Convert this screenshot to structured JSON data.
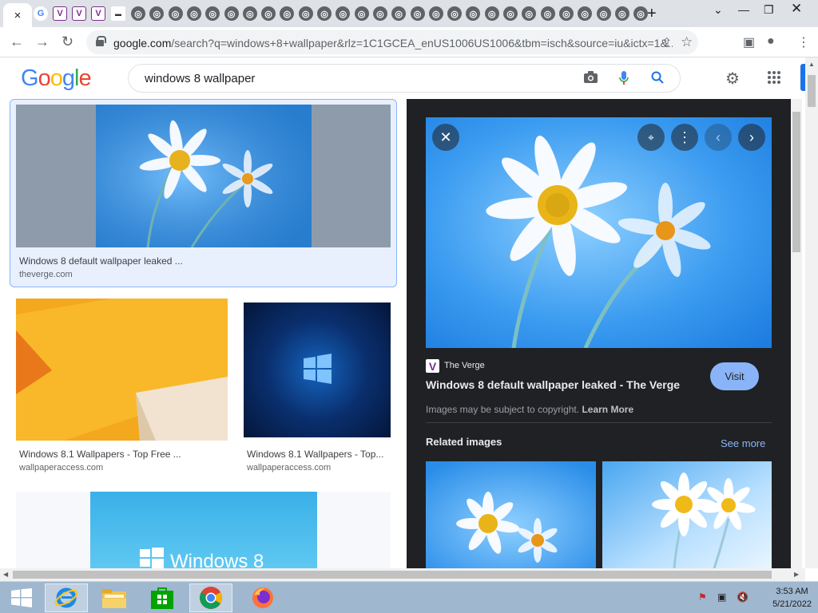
{
  "browser": {
    "active_tab_close": "×",
    "new_tab": "+",
    "url_host": "google.com",
    "url_rest": "/search?q=windows+8+wallpaper&rlz=1C1GCEA_enUS1006US1006&tbm=isch&source=iu&ictx=1&..."
  },
  "google": {
    "logo": "Google",
    "query": "windows 8 wallpaper"
  },
  "results": [
    {
      "title": "Windows 8 default wallpaper leaked ...",
      "source": "theverge.com"
    },
    {
      "title": "Windows 8.1 Wallpapers - Top Free ...",
      "source": "wallpaperaccess.com"
    },
    {
      "title": "Windows 8.1 Wallpapers - Top...",
      "source": "wallpaperaccess.com"
    },
    {
      "title": "Windows 8",
      "source": ""
    }
  ],
  "preview": {
    "source_name": "The Verge",
    "title": "Windows 8 default wallpaper leaked - The Verge",
    "visit_label": "Visit",
    "copyright_text": "Images may be subject to copyright.",
    "learn_more": "Learn More",
    "related_heading": "Related images",
    "see_more": "See more"
  },
  "taskbar": {
    "time": "3:53 AM",
    "date": "5/21/2022"
  },
  "colors": {
    "accent": "#1a73e8",
    "panel_bg": "#202124",
    "visit_button": "#8ab4f8",
    "taskbar": "#9fb7cf"
  }
}
